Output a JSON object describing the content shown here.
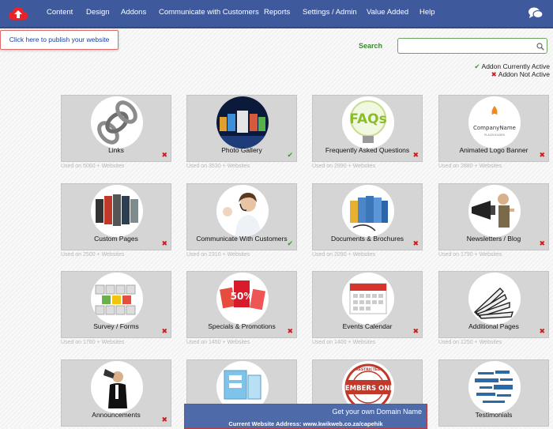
{
  "nav": {
    "items": [
      "Content",
      "Design",
      "Addons",
      "Communicate with Customers",
      "Reports",
      "Settings / Admin",
      "Value Added",
      "Help"
    ]
  },
  "publish": {
    "label": "Click here to publish your website"
  },
  "search": {
    "label": "Search",
    "value": "",
    "placeholder": ""
  },
  "legend": {
    "active": "Addon Currently Active",
    "inactive": "Addon Not Active"
  },
  "colors": {
    "nav": "#3e5a9c",
    "active": "#3a9a2a",
    "inactive": "#d11b1b",
    "search_label": "#3b8a2e"
  },
  "addons": [
    {
      "label": "Links",
      "usage": "Used on 5060 + Websites",
      "active": false,
      "icon": "chain-links-icon"
    },
    {
      "label": "Photo Gallery",
      "usage": "Used on 3530 + Websites",
      "active": true,
      "icon": "photo-screens-icon"
    },
    {
      "label": "Frequently Asked Questions",
      "usage": "Used on 2990 + Websites",
      "active": false,
      "icon": "faqs-bulb-icon"
    },
    {
      "label": "Animated Logo Banner",
      "usage": "Used on 2880 + Websites",
      "active": false,
      "icon": "company-logo-icon"
    },
    {
      "label": "Custom Pages",
      "usage": "Used on 2500 + Websites",
      "active": false,
      "icon": "pages-icon"
    },
    {
      "label": "Communicate With Customers",
      "usage": "Used on 2310 + Websites",
      "active": true,
      "icon": "headset-operator-icon"
    },
    {
      "label": "Documents & Brochures",
      "usage": "Used on 2090 + Websites",
      "active": false,
      "icon": "folders-icon"
    },
    {
      "label": "Newsletters / Blog",
      "usage": "Used on 1790 + Websites",
      "active": false,
      "icon": "megaphone-man-icon"
    },
    {
      "label": "Survey / Forms",
      "usage": "Used on 1760 + Websites",
      "active": false,
      "icon": "smiley-keyboard-icon"
    },
    {
      "label": "Specials & Promotions",
      "usage": "Used on 1450 + Websites",
      "active": false,
      "icon": "sale-tags-icon"
    },
    {
      "label": "Events Calendar",
      "usage": "Used on 1400 + Websites",
      "active": false,
      "icon": "calendar-icon"
    },
    {
      "label": "Additional Pages",
      "usage": "Used on 1250 + Websites",
      "active": false,
      "icon": "fanned-pages-icon"
    },
    {
      "label": "Announcements",
      "usage": "",
      "active": false,
      "icon": "announcer-megaphone-icon"
    },
    {
      "label": "",
      "usage": "",
      "active": false,
      "icon": "mobile-devices-icon"
    },
    {
      "label": "",
      "usage": "",
      "active": false,
      "icon": "members-only-stamp-icon",
      "stamp_text": "MEMBERS ONLY",
      "stamp_ring": "RESTRICTED"
    },
    {
      "label": "Testimonials",
      "usage": "",
      "active": false,
      "icon": "word-cloud-icon"
    }
  ],
  "domain_bar": {
    "title": "Get your own Domain Name",
    "address": "Current Website Address: www.kwikweb.co.za/capehik"
  }
}
